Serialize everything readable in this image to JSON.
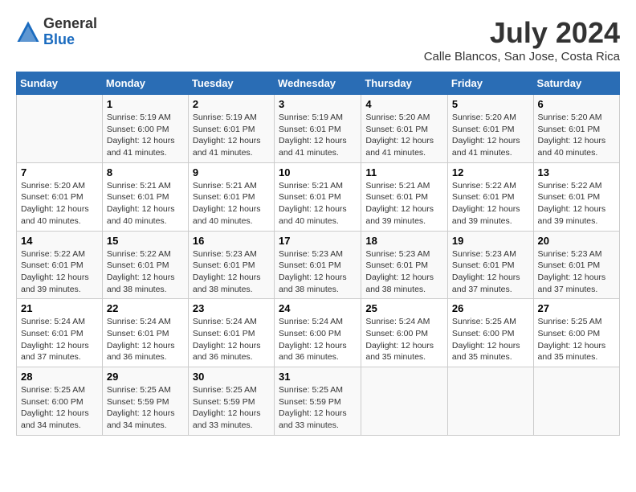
{
  "logo": {
    "general": "General",
    "blue": "Blue"
  },
  "title": "July 2024",
  "location": "Calle Blancos, San Jose, Costa Rica",
  "days_of_week": [
    "Sunday",
    "Monday",
    "Tuesday",
    "Wednesday",
    "Thursday",
    "Friday",
    "Saturday"
  ],
  "weeks": [
    [
      {
        "num": "",
        "info": ""
      },
      {
        "num": "1",
        "info": "Sunrise: 5:19 AM\nSunset: 6:00 PM\nDaylight: 12 hours\nand 41 minutes."
      },
      {
        "num": "2",
        "info": "Sunrise: 5:19 AM\nSunset: 6:01 PM\nDaylight: 12 hours\nand 41 minutes."
      },
      {
        "num": "3",
        "info": "Sunrise: 5:19 AM\nSunset: 6:01 PM\nDaylight: 12 hours\nand 41 minutes."
      },
      {
        "num": "4",
        "info": "Sunrise: 5:20 AM\nSunset: 6:01 PM\nDaylight: 12 hours\nand 41 minutes."
      },
      {
        "num": "5",
        "info": "Sunrise: 5:20 AM\nSunset: 6:01 PM\nDaylight: 12 hours\nand 41 minutes."
      },
      {
        "num": "6",
        "info": "Sunrise: 5:20 AM\nSunset: 6:01 PM\nDaylight: 12 hours\nand 40 minutes."
      }
    ],
    [
      {
        "num": "7",
        "info": "Sunrise: 5:20 AM\nSunset: 6:01 PM\nDaylight: 12 hours\nand 40 minutes."
      },
      {
        "num": "8",
        "info": "Sunrise: 5:21 AM\nSunset: 6:01 PM\nDaylight: 12 hours\nand 40 minutes."
      },
      {
        "num": "9",
        "info": "Sunrise: 5:21 AM\nSunset: 6:01 PM\nDaylight: 12 hours\nand 40 minutes."
      },
      {
        "num": "10",
        "info": "Sunrise: 5:21 AM\nSunset: 6:01 PM\nDaylight: 12 hours\nand 40 minutes."
      },
      {
        "num": "11",
        "info": "Sunrise: 5:21 AM\nSunset: 6:01 PM\nDaylight: 12 hours\nand 39 minutes."
      },
      {
        "num": "12",
        "info": "Sunrise: 5:22 AM\nSunset: 6:01 PM\nDaylight: 12 hours\nand 39 minutes."
      },
      {
        "num": "13",
        "info": "Sunrise: 5:22 AM\nSunset: 6:01 PM\nDaylight: 12 hours\nand 39 minutes."
      }
    ],
    [
      {
        "num": "14",
        "info": "Sunrise: 5:22 AM\nSunset: 6:01 PM\nDaylight: 12 hours\nand 39 minutes."
      },
      {
        "num": "15",
        "info": "Sunrise: 5:22 AM\nSunset: 6:01 PM\nDaylight: 12 hours\nand 38 minutes."
      },
      {
        "num": "16",
        "info": "Sunrise: 5:23 AM\nSunset: 6:01 PM\nDaylight: 12 hours\nand 38 minutes."
      },
      {
        "num": "17",
        "info": "Sunrise: 5:23 AM\nSunset: 6:01 PM\nDaylight: 12 hours\nand 38 minutes."
      },
      {
        "num": "18",
        "info": "Sunrise: 5:23 AM\nSunset: 6:01 PM\nDaylight: 12 hours\nand 38 minutes."
      },
      {
        "num": "19",
        "info": "Sunrise: 5:23 AM\nSunset: 6:01 PM\nDaylight: 12 hours\nand 37 minutes."
      },
      {
        "num": "20",
        "info": "Sunrise: 5:23 AM\nSunset: 6:01 PM\nDaylight: 12 hours\nand 37 minutes."
      }
    ],
    [
      {
        "num": "21",
        "info": "Sunrise: 5:24 AM\nSunset: 6:01 PM\nDaylight: 12 hours\nand 37 minutes."
      },
      {
        "num": "22",
        "info": "Sunrise: 5:24 AM\nSunset: 6:01 PM\nDaylight: 12 hours\nand 36 minutes."
      },
      {
        "num": "23",
        "info": "Sunrise: 5:24 AM\nSunset: 6:01 PM\nDaylight: 12 hours\nand 36 minutes."
      },
      {
        "num": "24",
        "info": "Sunrise: 5:24 AM\nSunset: 6:00 PM\nDaylight: 12 hours\nand 36 minutes."
      },
      {
        "num": "25",
        "info": "Sunrise: 5:24 AM\nSunset: 6:00 PM\nDaylight: 12 hours\nand 35 minutes."
      },
      {
        "num": "26",
        "info": "Sunrise: 5:25 AM\nSunset: 6:00 PM\nDaylight: 12 hours\nand 35 minutes."
      },
      {
        "num": "27",
        "info": "Sunrise: 5:25 AM\nSunset: 6:00 PM\nDaylight: 12 hours\nand 35 minutes."
      }
    ],
    [
      {
        "num": "28",
        "info": "Sunrise: 5:25 AM\nSunset: 6:00 PM\nDaylight: 12 hours\nand 34 minutes."
      },
      {
        "num": "29",
        "info": "Sunrise: 5:25 AM\nSunset: 5:59 PM\nDaylight: 12 hours\nand 34 minutes."
      },
      {
        "num": "30",
        "info": "Sunrise: 5:25 AM\nSunset: 5:59 PM\nDaylight: 12 hours\nand 33 minutes."
      },
      {
        "num": "31",
        "info": "Sunrise: 5:25 AM\nSunset: 5:59 PM\nDaylight: 12 hours\nand 33 minutes."
      },
      {
        "num": "",
        "info": ""
      },
      {
        "num": "",
        "info": ""
      },
      {
        "num": "",
        "info": ""
      }
    ]
  ]
}
